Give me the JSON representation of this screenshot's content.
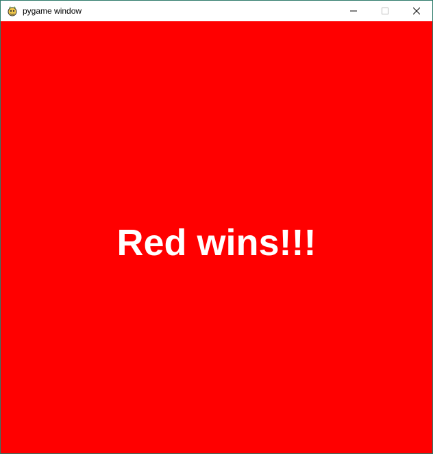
{
  "window": {
    "title": "pygame window",
    "icon": "pygame-snake-icon",
    "controls": {
      "minimize_icon": "minimize-icon",
      "maximize_icon": "maximize-icon",
      "close_icon": "close-icon"
    }
  },
  "game": {
    "background_color": "#ff0000",
    "text_color": "#ffffff",
    "message": "Red wins!!!"
  }
}
